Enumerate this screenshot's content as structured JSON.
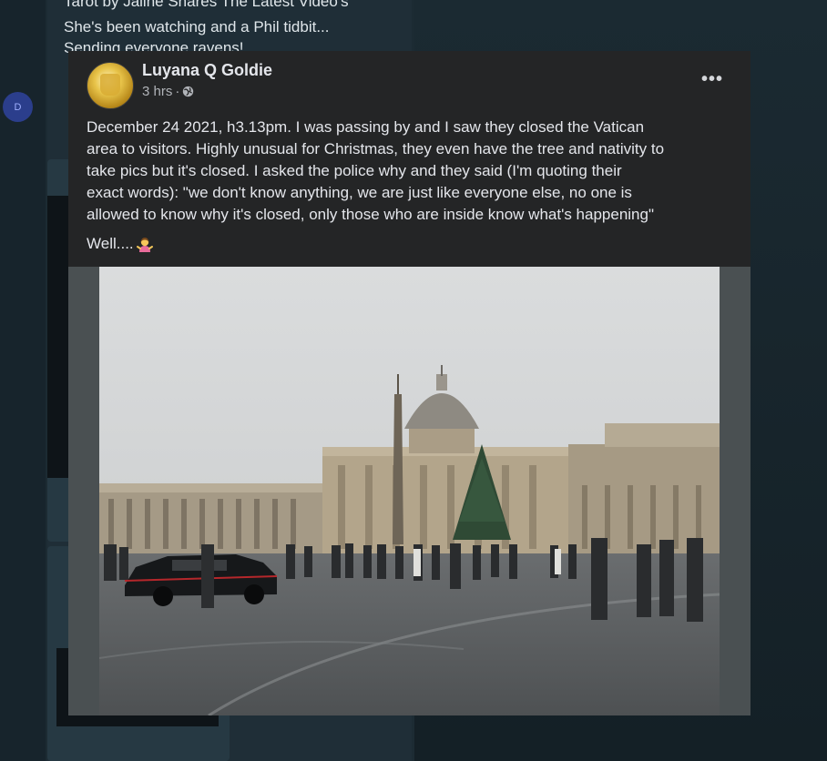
{
  "background": {
    "avatar_letter": "D",
    "lines": [
      "Tarot by Jaline Shares The Latest Video's",
      "She's been watching and a Phil tidbit...",
      "Sending everyone ravens!"
    ]
  },
  "post": {
    "author": "Luyana Q Goldie",
    "time": "3 hrs",
    "separator": "·",
    "more_label": "•••",
    "text_lines": [
      "December 24 2021, h3.13pm. I was passing by and I saw they closed the Vatican",
      "area to visitors. Highly unusual for Christmas, they even have the tree and nativity to",
      "take pics but it's closed. I asked the police why and they said (I'm quoting their",
      "exact words): \"we don't know anything, we are just like everyone else, no one is",
      "allowed to know why it's closed, only those who are inside know what's happening\""
    ],
    "closing": "Well....",
    "photo_alt": "St. Peter's Square, Vatican"
  },
  "icons": {
    "privacy": "globe-icon",
    "reaction": "shrugging-woman-emoji",
    "more": "more-options-icon"
  },
  "colors": {
    "post_bg": "#242526",
    "text": "#e4e6eb",
    "muted": "#b0b3b8"
  }
}
